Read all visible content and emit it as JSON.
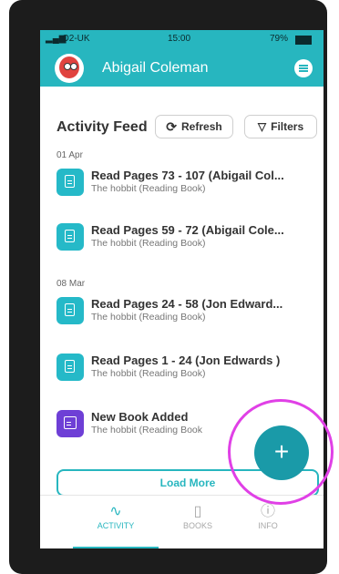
{
  "status": {
    "carrier": "O2-UK",
    "time": "15:00",
    "battery": "79%"
  },
  "appbar": {
    "user_name": "Abigail Coleman"
  },
  "feed": {
    "title": "Activity Feed",
    "refresh_label": "Refresh",
    "filters_label": "Filters",
    "groups": [
      {
        "date": "01 Apr",
        "items": [
          {
            "title": "Read Pages 73 - 107 (Abigail Col...",
            "subtitle": "The hobbit  (Reading Book)"
          },
          {
            "title": "Read Pages 59 - 72 (Abigail Cole...",
            "subtitle": "The hobbit  (Reading Book)"
          }
        ]
      },
      {
        "date": "08 Mar",
        "items": [
          {
            "title": "Read Pages 24 - 58 (Jon Edward...",
            "subtitle": "The hobbit  (Reading Book)"
          },
          {
            "title": "Read Pages 1 - 24 (Jon Edwards )",
            "subtitle": "The hobbit  (Reading Book)"
          },
          {
            "title": "New Book Added",
            "subtitle": "The hobbit  (Reading Book"
          }
        ]
      }
    ],
    "load_more_label": "Load More"
  },
  "nav": {
    "tabs": [
      {
        "label": "ACTIVITY",
        "icon": "activity-icon",
        "active": true
      },
      {
        "label": "BOOKS",
        "icon": "book-icon",
        "active": false
      },
      {
        "label": "INFO",
        "icon": "info-icon",
        "active": false
      }
    ]
  },
  "fab": {
    "symbol": "+"
  },
  "colors": {
    "accent": "#27b6bf",
    "purple": "#6e3fd6",
    "highlight_ring": "#e040e6"
  }
}
